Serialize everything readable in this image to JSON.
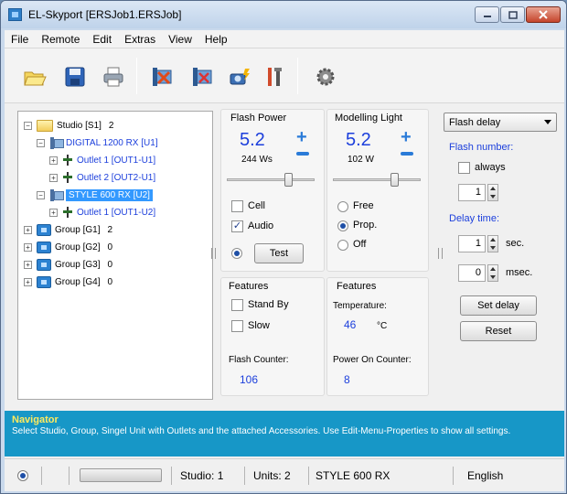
{
  "window": {
    "title": "EL-Skyport [ERSJob1.ERSJob]"
  },
  "menu": [
    "File",
    "Remote",
    "Edit",
    "Extras",
    "View",
    "Help"
  ],
  "toolbar_icons": [
    "open-folder-icon",
    "save-icon",
    "print-icon",
    "unit-scan-icon",
    "unit-remove-icon",
    "camera-flash-icon",
    "tools-icon",
    "settings-gear-icon"
  ],
  "tree": {
    "studio": {
      "label": "Studio [S1]",
      "count": "2"
    },
    "unit1": {
      "label": "DIGITAL 1200 RX [U1]"
    },
    "outlet1": {
      "label": "Outlet 1 [OUT1-U1]"
    },
    "outlet2": {
      "label": "Outlet 2 [OUT2-U1]"
    },
    "unit2": {
      "label": "STYLE 600 RX [U2]"
    },
    "outlet3": {
      "label": "Outlet 1 [OUT1-U2]"
    },
    "groups": [
      {
        "label": "Group [G1]",
        "count": "2"
      },
      {
        "label": "Group [G2]",
        "count": "0"
      },
      {
        "label": "Group [G3]",
        "count": "0"
      },
      {
        "label": "Group [G4]",
        "count": "0"
      }
    ]
  },
  "flash_power": {
    "title": "Flash Power",
    "value": "5.2",
    "ws": "244 Ws",
    "slider_level": 0.7,
    "cell_label": "Cell",
    "cell_checked": false,
    "audio_label": "Audio",
    "audio_checked": true,
    "test_label": "Test"
  },
  "modelling_light": {
    "title": "Modelling Light",
    "value": "5.2",
    "watts": "102 W",
    "slider_level": 0.7,
    "options": [
      "Free",
      "Prop.",
      "Off"
    ],
    "selected": "Prop."
  },
  "features_left": {
    "title": "Features",
    "standby_label": "Stand By",
    "slow_label": "Slow",
    "counter_label": "Flash Counter:",
    "counter_value": "106"
  },
  "features_right": {
    "title": "Features",
    "temp_label": "Temperature:",
    "temp_value": "46",
    "temp_unit": "°C",
    "power_label": "Power On Counter:",
    "power_value": "8"
  },
  "delay": {
    "mode": "Flash delay",
    "flash_number_label": "Flash number:",
    "always_label": "always",
    "flash_number_value": "1",
    "delay_time_label": "Delay time:",
    "sec_value": "1",
    "sec_unit": "sec.",
    "msec_value": "0",
    "msec_unit": "msec.",
    "set_delay_label": "Set delay",
    "reset_label": "Reset"
  },
  "navigator": {
    "title": "Navigator",
    "text": "Select Studio, Group,  Singel Unit with Outlets and the attached Accessories. Use Edit-Menu-Properties to show all settings."
  },
  "status": {
    "studio": "Studio: 1",
    "units": "Units: 2",
    "model": "STYLE 600 RX",
    "language": "English"
  },
  "colors": {
    "accent_blue": "#1c3fdc",
    "selection": "#3399ff",
    "navigator_bg": "#1797c7",
    "navigator_title": "#ffea5e"
  }
}
